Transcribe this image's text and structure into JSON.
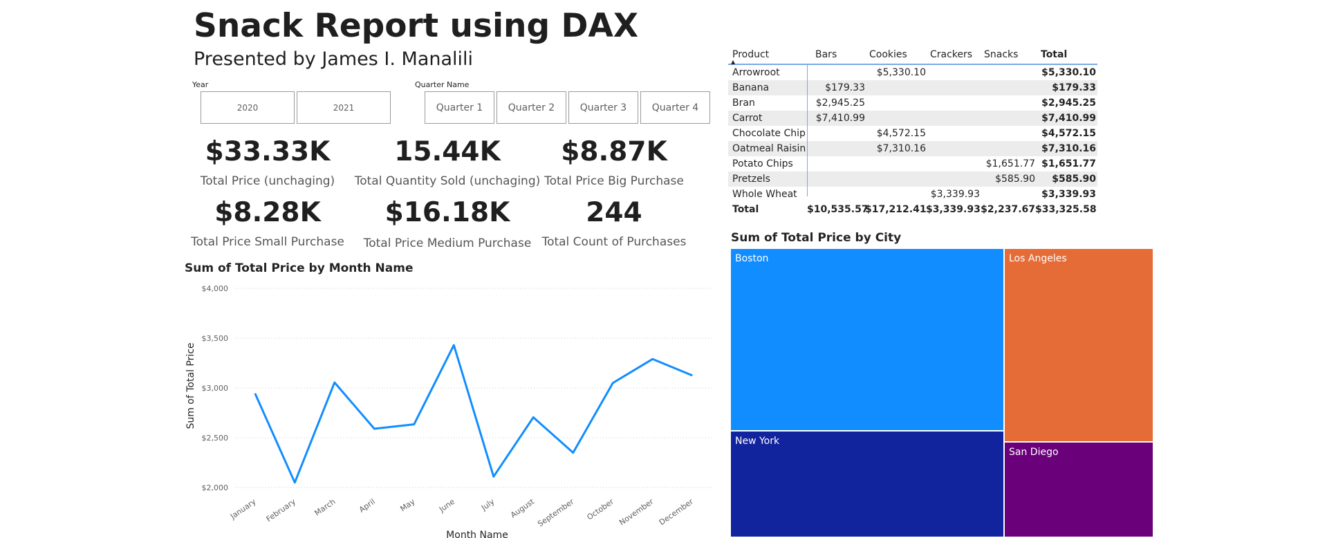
{
  "report": {
    "title": "Snack Report using DAX",
    "subtitle": "Presented by James I. Manalili"
  },
  "slicers": {
    "year": {
      "label": "Year",
      "options": [
        "2020",
        "2021"
      ]
    },
    "quarter": {
      "label": "Quarter Name",
      "options": [
        "Quarter 1",
        "Quarter 2",
        "Quarter 3",
        "Quarter 4"
      ]
    }
  },
  "kpis": [
    {
      "value": "$33.33K",
      "label": "Total Price (unchaging)"
    },
    {
      "value": "15.44K",
      "label": "Total Quantity Sold (unchaging)"
    },
    {
      "value": "$8.87K",
      "label": "Total Price Big Purchase"
    },
    {
      "value": "$8.28K",
      "label": "Total Price Small Purchase"
    },
    {
      "value": "$16.18K",
      "label": "Total Price Medium Purchase"
    },
    {
      "value": "244",
      "label": "Total Count of Purchases"
    }
  ],
  "matrix": {
    "headers": [
      "Product",
      "Bars",
      "Cookies",
      "Crackers",
      "Snacks",
      "Total"
    ],
    "sort_indicator": "▲",
    "rows": [
      [
        "Arrowroot",
        "",
        "$5,330.10",
        "",
        "",
        "$5,330.10"
      ],
      [
        "Banana",
        "$179.33",
        "",
        "",
        "",
        "$179.33"
      ],
      [
        "Bran",
        "$2,945.25",
        "",
        "",
        "",
        "$2,945.25"
      ],
      [
        "Carrot",
        "$7,410.99",
        "",
        "",
        "",
        "$7,410.99"
      ],
      [
        "Chocolate Chip",
        "",
        "$4,572.15",
        "",
        "",
        "$4,572.15"
      ],
      [
        "Oatmeal Raisin",
        "",
        "$7,310.16",
        "",
        "",
        "$7,310.16"
      ],
      [
        "Potato Chips",
        "",
        "",
        "",
        "$1,651.77",
        "$1,651.77"
      ],
      [
        "Pretzels",
        "",
        "",
        "",
        "$585.90",
        "$585.90"
      ],
      [
        "Whole Wheat",
        "",
        "",
        "$3,339.93",
        "",
        "$3,339.93"
      ]
    ],
    "total_row": [
      "Total",
      "$10,535.57",
      "$17,212.41",
      "$3,339.93",
      "$2,237.67",
      "$33,325.58"
    ]
  },
  "treemap": {
    "title": "Sum of Total Price by City",
    "items": [
      {
        "label": "Boston",
        "color": "#118dff"
      },
      {
        "label": "Los Angeles",
        "color": "#e66c37"
      },
      {
        "label": "New York",
        "color": "#12239e"
      },
      {
        "label": "San Diego",
        "color": "#6b007b"
      }
    ]
  },
  "chart_data": {
    "type": "line",
    "title": "Sum of Total Price by Month Name",
    "xlabel": "Month Name",
    "ylabel": "Sum of Total Price",
    "categories": [
      "January",
      "February",
      "March",
      "April",
      "May",
      "June",
      "July",
      "August",
      "September",
      "October",
      "November",
      "December"
    ],
    "series": [
      {
        "values": [
          2945,
          2050,
          3055,
          2590,
          2635,
          3430,
          2110,
          2705,
          2350,
          3050,
          3290,
          3125
        ]
      }
    ],
    "ylim": [
      2000,
      4000
    ],
    "yticks": [
      2000,
      2500,
      3000,
      3500,
      4000
    ],
    "ytick_labels": [
      "$2,000",
      "$2,500",
      "$3,000",
      "$3,500",
      "$4,000"
    ],
    "grid": true,
    "line_color": "#118dff"
  }
}
